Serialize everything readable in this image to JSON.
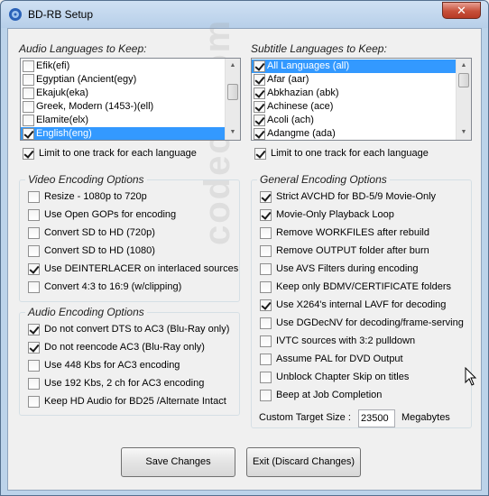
{
  "window": {
    "title": "BD-RB Setup",
    "close_label": "✕"
  },
  "audio_languages": {
    "label": "Audio Languages to Keep:",
    "items": [
      {
        "label": "Efik(efi)",
        "checked": false,
        "selected": false
      },
      {
        "label": "Egyptian (Ancient(egy)",
        "checked": false,
        "selected": false
      },
      {
        "label": "Ekajuk(eka)",
        "checked": false,
        "selected": false
      },
      {
        "label": "Greek, Modern (1453-)(ell)",
        "checked": false,
        "selected": false
      },
      {
        "label": "Elamite(elx)",
        "checked": false,
        "selected": false
      },
      {
        "label": "English(eng)",
        "checked": true,
        "selected": true
      }
    ],
    "limit_label": "Limit to one track for each language",
    "limit_checked": true
  },
  "subtitle_languages": {
    "label": "Subtitle Languages to Keep:",
    "items": [
      {
        "label": "All Languages (all)",
        "checked": true,
        "selected": true
      },
      {
        "label": "Afar (aar)",
        "checked": true,
        "selected": false
      },
      {
        "label": "Abkhazian (abk)",
        "checked": true,
        "selected": false
      },
      {
        "label": "Achinese (ace)",
        "checked": true,
        "selected": false
      },
      {
        "label": "Acoli (ach)",
        "checked": true,
        "selected": false
      },
      {
        "label": "Adangme (ada)",
        "checked": true,
        "selected": false
      }
    ],
    "limit_label": "Limit to one track for each language",
    "limit_checked": true
  },
  "video_encoding": {
    "title": "Video Encoding Options",
    "options": [
      {
        "label": "Resize  - 1080p to 720p",
        "checked": false
      },
      {
        "label": "Use Open GOPs for encoding",
        "checked": false
      },
      {
        "label": "Convert SD to HD (720p)",
        "checked": false
      },
      {
        "label": "Convert SD to HD (1080)",
        "checked": false
      },
      {
        "label": "Use DEINTERLACER on interlaced sources",
        "checked": true
      },
      {
        "label": "Convert 4:3 to 16:9 (w/clipping)",
        "checked": false
      }
    ]
  },
  "audio_encoding": {
    "title": "Audio Encoding Options",
    "options": [
      {
        "label": "Do not convert DTS to AC3  (Blu-Ray only)",
        "checked": true
      },
      {
        "label": "Do not reencode AC3  (Blu-Ray only)",
        "checked": true
      },
      {
        "label": "Use 448 Kbs for AC3 encoding",
        "checked": false
      },
      {
        "label": "Use 192 Kbs, 2 ch for AC3 encoding",
        "checked": false
      },
      {
        "label": "Keep HD Audio for BD25 /Alternate Intact",
        "checked": false
      }
    ]
  },
  "general_encoding": {
    "title": "General Encoding Options",
    "options": [
      {
        "label": "Strict AVCHD for BD-5/9 Movie-Only",
        "checked": true
      },
      {
        "label": "Movie-Only Playback Loop",
        "checked": true
      },
      {
        "label": "Remove WORKFILES after rebuild",
        "checked": false
      },
      {
        "label": "Remove OUTPUT folder after burn",
        "checked": false
      },
      {
        "label": "Use AVS Filters during encoding",
        "checked": false
      },
      {
        "label": "Keep only BDMV/CERTIFICATE folders",
        "checked": false
      },
      {
        "label": "Use X264's internal LAVF for decoding",
        "checked": true
      },
      {
        "label": "Use DGDecNV for decoding/frame-serving",
        "checked": false
      },
      {
        "label": "IVTC sources with 3:2 pulldown",
        "checked": false
      },
      {
        "label": "Assume PAL for DVD Output",
        "checked": false
      },
      {
        "label": "Unblock Chapter Skip on titles",
        "checked": false
      },
      {
        "label": "Beep at Job Completion",
        "checked": false
      }
    ],
    "custom_target_label": "Custom Target Size :",
    "custom_target_value": "23500",
    "custom_target_unit": "Megabytes"
  },
  "buttons": {
    "save": "Save Changes",
    "exit": "Exit (Discard Changes)"
  },
  "watermark": "codecs.com"
}
